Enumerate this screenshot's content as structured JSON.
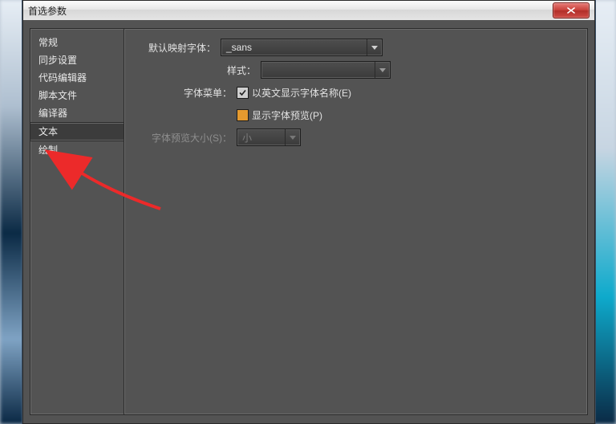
{
  "window": {
    "title": "首选参数"
  },
  "sidebar": {
    "items": [
      {
        "label": "常规"
      },
      {
        "label": "同步设置"
      },
      {
        "label": "代码编辑器"
      },
      {
        "label": "脚本文件"
      },
      {
        "label": "编译器"
      },
      {
        "label": "文本"
      },
      {
        "label": "绘制"
      }
    ],
    "selected_index": 5
  },
  "content": {
    "default_font_label": "默认映射字体：",
    "default_font_value": "_sans",
    "style_label": "样式：",
    "style_value": "",
    "font_menu_label": "字体菜单：",
    "checkbox_english_names": "以英文显示字体名称(E)",
    "checkbox_english_names_checked": true,
    "checkbox_font_preview": "显示字体预览(P)",
    "checkbox_font_preview_checked": false,
    "preview_size_label": "字体预览大小(S)：",
    "preview_size_value": "小"
  }
}
